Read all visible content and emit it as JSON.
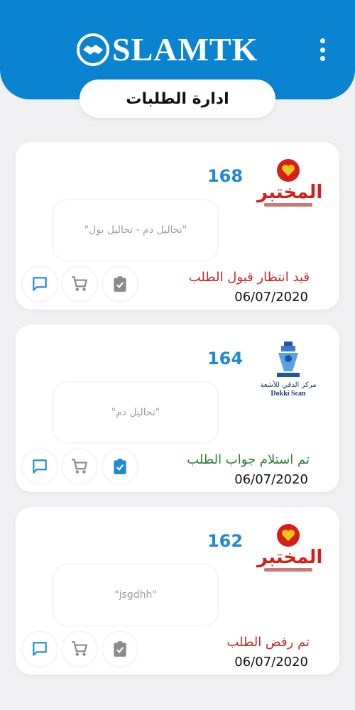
{
  "header": {
    "brand": "SLAMTK",
    "page_title": "ادارة الطلبات",
    "accent_color": "#0a83d0",
    "menu_icon": "more-vertical-icon"
  },
  "orders": [
    {
      "id": "168",
      "provider_logo": "al-mokhtabar-logo",
      "provider_logo_text": "المختبر",
      "note": "\"تحاليل دم - تحاليل بول\"",
      "status": "قيد انتظار قبول الطلب",
      "status_color": "#c62828",
      "date": "06/07/2020",
      "check_active": false
    },
    {
      "id": "164",
      "provider_logo": "dokki-scan-logo",
      "provider_logo_text": "مركز الدقي للأشعة",
      "provider_logo_subtext": "Dokki Scan",
      "note": "\"تحاليل دم\"",
      "status": "تم استلام جواب الطلب",
      "status_color": "#2e7d32",
      "date": "06/07/2020",
      "check_active": true
    },
    {
      "id": "162",
      "provider_logo": "al-mokhtabar-logo",
      "provider_logo_text": "المختبر",
      "note": "\"jsgdhh\"",
      "status": "تم رفض الطلب",
      "status_color": "#c62828",
      "date": "06/07/2020",
      "check_active": false
    }
  ],
  "icons": {
    "chat": "chat-icon",
    "cart": "cart-icon",
    "check": "clipboard-check-icon"
  }
}
